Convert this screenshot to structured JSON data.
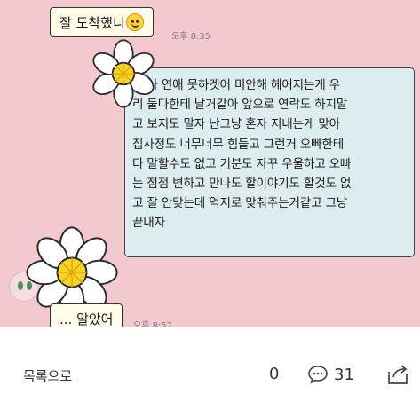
{
  "chat": {
    "msg_top": "잘 도착했니",
    "time_top": "오후 8:35",
    "main_lines": [
      "나 나 연애 못하겟어 미안해 헤어지는게 우",
      "리 둘다한테 날거같아 앞으로 연락도 하지말",
      "고 보지도 말자 난그냥 혼자 지내는게 맞아",
      "집사정도 너무너무 힘들고 그런거 오빠한테",
      "다 말할수도 없고 기분도 자꾸 우울하고 오빠",
      "는 점점 변하고 만나도 할이야기도 할것도 없",
      "고 잘 안맞는데 억지로 맞춰주는거같고 그냥",
      "끝내자"
    ],
    "msg_bottom": "... 알았어",
    "time_bottom": "오후 8:57",
    "emoticon_icon": "smiley-face-icon",
    "sticker_icon": "daisy-flower-icon"
  },
  "footer": {
    "back_label": "목록으로",
    "like_count": "0",
    "comment_count": "31",
    "comment_icon": "speech-bubble-icon",
    "share_icon": "share-icon"
  },
  "colors": {
    "chat_background": "#f3c9d0",
    "main_bubble": "#ddecee",
    "small_bubble": "#fffbe9",
    "flower_center": "#f6d32a"
  }
}
